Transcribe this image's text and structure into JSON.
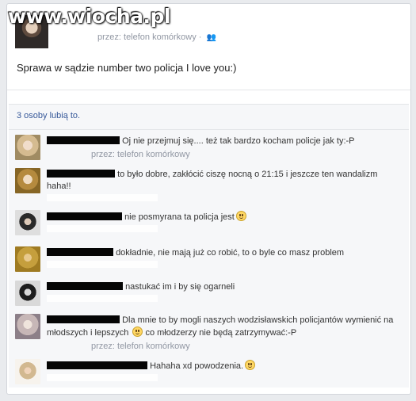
{
  "watermark": "www.wiocha.pl",
  "post": {
    "via_text": "przez: telefon komórkowy · ",
    "audience_icon": "people-icon",
    "status": "Sprawa w sądzie number two policja I love you:)"
  },
  "likes": {
    "text": "3 osoby lubią to."
  },
  "comments": [
    {
      "text": "Oj nie przejmuj się.... też tak bardzo kocham policje jak ty:-P",
      "via": "przez: telefon komórkowy"
    },
    {
      "text": "to było dobre, zakłócić ciszę nocną o 21:15 i jeszcze ten wandalizm haha!!"
    },
    {
      "text": "nie posmyrana ta policja jest",
      "emoji": "smiley-icon"
    },
    {
      "text": "dokładnie, nie mają już co robić, to o byle co masz problem"
    },
    {
      "text": "nastukać im i by się ogarneli"
    },
    {
      "text_a": "Dla mnie to by mogli naszych wodzisławskich policjantów wymienić na młodszych i lepszych",
      "text_b": "co młodzerzy nie będą zatrzymywać:-P",
      "via": "przez: telefon komórkowy",
      "emoji": "smiley-icon"
    },
    {
      "text": "Hahaha xd powodzenia.",
      "emoji": "smiley-icon"
    }
  ],
  "colors": {
    "link": "#365899",
    "muted": "#9197a3",
    "panel": "#f6f7f9"
  }
}
